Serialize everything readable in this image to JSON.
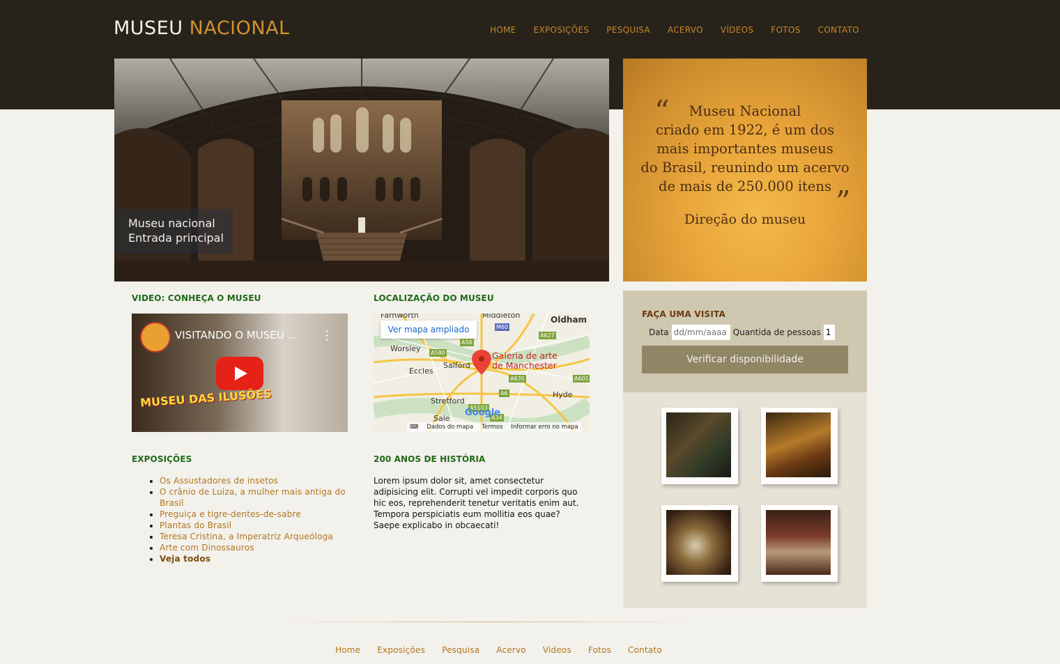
{
  "header": {
    "logo_word1": "MUSEU",
    "logo_word2": "NACIONAL",
    "nav": [
      "HOME",
      "EXPOSIÇÕES",
      "PESQUISA",
      "ACERVO",
      "VÍDEOS",
      "FOTOS",
      "CONTATO"
    ]
  },
  "hero": {
    "caption_line1": "Museu nacional",
    "caption_line2": "Entrada principal"
  },
  "quote": {
    "open_mark": "“",
    "close_mark": "”",
    "lines": [
      "Museu Nacional",
      "criado em 1922, é um dos",
      "mais importantes museus",
      "do Brasil, reunindo um acervo",
      "de mais de 250.000 itens"
    ],
    "signature": "Direção do museu"
  },
  "visit": {
    "title": "FAÇA UMA VISITA",
    "date_label": "Data",
    "date_placeholder": "dd/mm/aaaa",
    "people_label": "Quantida de pessoas",
    "people_value": "1",
    "button": "Verificar disponibilidade"
  },
  "video": {
    "section_title": "VIDEO: CONHEÇA O MUSEU",
    "title": "VISITANDO O MUSEU ...",
    "badge_text": "MUSEU DAS ILUSÕES",
    "menu_icon": "kebab-icon",
    "play_icon": "youtube-play-icon"
  },
  "map": {
    "section_title": "LOCALIZAÇÃO DO MUSEU",
    "link": "Ver mapa ampliado",
    "pin_label_line1": "Galeria de arte",
    "pin_label_line2": "de Manchester",
    "places": [
      "Farnworth",
      "Middleton",
      "Oldham",
      "Worsley",
      "Salford",
      "Eccles",
      "Hyde",
      "Stretford",
      "Sale"
    ],
    "roads": [
      "M60",
      "A627",
      "A56",
      "A580",
      "A635",
      "A601",
      "A6",
      "A5103",
      "A34"
    ],
    "google": "Google",
    "footer": [
      "Dados do mapa",
      "Termos",
      "Informar erro no mapa"
    ]
  },
  "exposicoes": {
    "title": "EXPOSIÇÕES",
    "items": [
      "Os Assustadores de insetos",
      "O crânio de Luiza, a mulher mais antiga do Brasil",
      "Preguiça e tigre-dentes-de-sabre",
      "Plantas do Brasil",
      "Teresa Cristina, a Imperatriz Arqueóloga",
      "Arte com Dinossauros"
    ],
    "see_all": "Veja todos"
  },
  "history": {
    "title": "200 ANOS DE HISTÓRIA",
    "text": "Lorem ipsum dolor sit, amet consectetur adipisicing elit. Corrupti vel impedit corporis quo hic eos, reprehenderit tenetur veritatis enim aut. Tempora perspiciatis eum mollitia eos quae? Saepe explicabo in obcaecati!"
  },
  "footer": {
    "nav": [
      "Home",
      "Exposições",
      "Pesquisa",
      "Acervo",
      "Videos",
      "Fotos",
      "Contato"
    ]
  },
  "colors": {
    "header_bg": "#27231a",
    "accent_orange": "#c8862b",
    "section_green": "#1e6a1a",
    "visit_bg": "#cfc8b0",
    "button_bg": "#8f8666"
  }
}
